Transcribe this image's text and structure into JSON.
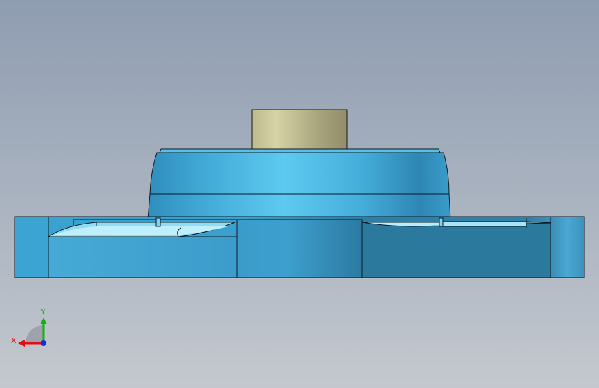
{
  "viewport": {
    "background_top": "#8f9db1",
    "background_bottom": "#c4c8ce"
  },
  "model": {
    "body_color": "#3fa6d2",
    "highlight_color": "#5cc8ee",
    "shadow_color": "#2c7d9e",
    "boss_color": "#b8b48a",
    "edge_color": "#0a1a24"
  },
  "triad": {
    "x_label": "X",
    "y_label": "Y",
    "x_color": "#e01010",
    "y_color": "#10b010",
    "z_color": "#1030e0"
  }
}
